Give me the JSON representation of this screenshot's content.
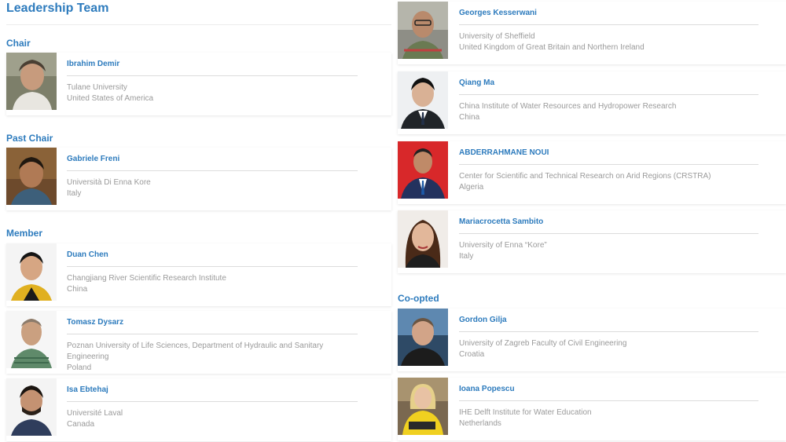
{
  "page": {
    "title": "Leadership Team"
  },
  "sections": {
    "chair": "Chair",
    "past_chair": "Past Chair",
    "member": "Member",
    "coopted": "Co-opted"
  },
  "people": {
    "chair_0": {
      "name": "Ibrahim Demir",
      "institution": "Tulane University",
      "country": "United States of America"
    },
    "past_0": {
      "name": "Gabriele Freni",
      "institution": "Università Di Enna Kore",
      "country": "Italy"
    },
    "member_0": {
      "name": "Duan Chen",
      "institution": "Changjiang River Scientific Research Institute",
      "country": "China"
    },
    "member_1": {
      "name": "Tomasz Dysarz",
      "institution": "Poznan University of Life Sciences, Department of Hydraulic and Sanitary Engineering",
      "country": "Poland"
    },
    "member_2": {
      "name": "Isa Ebtehaj",
      "institution": "Université Laval",
      "country": "Canada"
    },
    "member_3": {
      "name": "Georges Kesserwani",
      "institution": "University of Sheffield",
      "country": "United Kingdom of Great Britain and Northern Ireland"
    },
    "member_4": {
      "name": "Qiang Ma",
      "institution": "China Institute of Water Resources and Hydropower Research",
      "country": "China"
    },
    "member_5": {
      "name": "ABDERRAHMANE NOUI",
      "institution": "Center for Scientific and Technical Research on Arid Regions (CRSTRA)",
      "country": "Algeria"
    },
    "member_6": {
      "name": "Mariacrocetta Sambito",
      "institution": "University of Enna “Kore”",
      "country": "Italy"
    },
    "coopt_0": {
      "name": "Gordon Gilja",
      "institution": "University of Zagreb Faculty of Civil Engineering",
      "country": "Croatia"
    },
    "coopt_1": {
      "name": "Ioana Popescu",
      "institution": "IHE Delft Institute for Water Education",
      "country": "Netherlands"
    }
  },
  "colors": {
    "accent": "#2d7bbd",
    "muted": "#9a9a9a"
  }
}
